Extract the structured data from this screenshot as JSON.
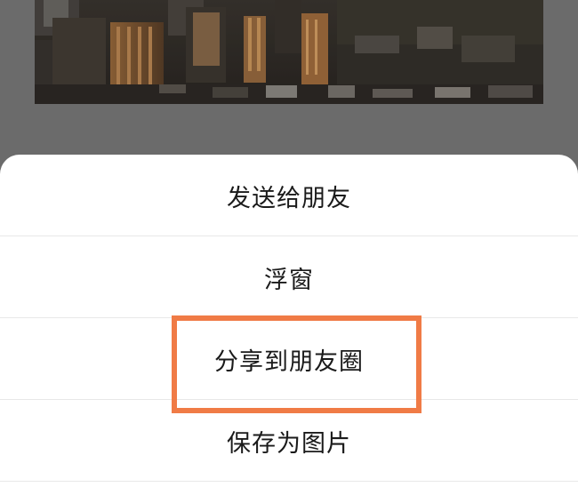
{
  "background_photo": {
    "description_icon": "city-skyline-photo"
  },
  "share_sheet": {
    "items": [
      {
        "label": "发送给朋友"
      },
      {
        "label": "浮窗"
      },
      {
        "label": "分享到朋友圈"
      },
      {
        "label": "保存为图片"
      }
    ]
  },
  "highlight_color": "#f07b46"
}
